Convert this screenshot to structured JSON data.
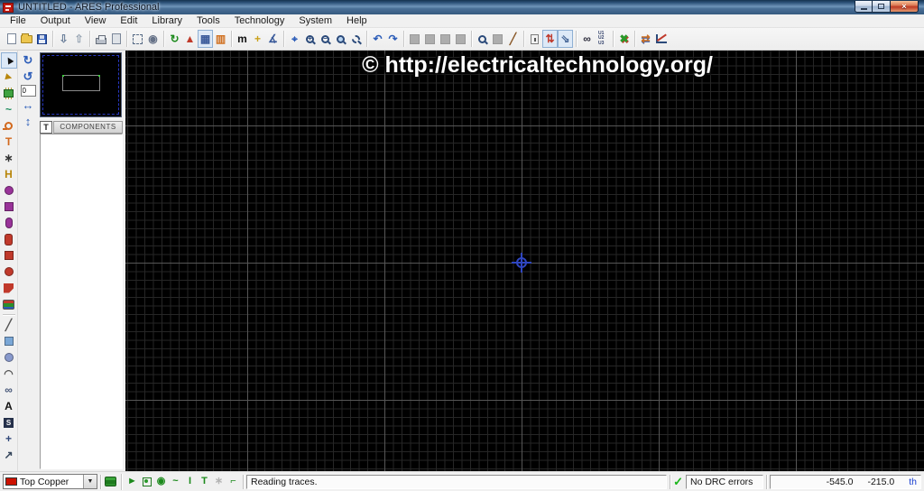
{
  "window": {
    "title": "UNTITLED - ARES Professional"
  },
  "title_bar": {
    "close_glyph": "×"
  },
  "menu_bar": {
    "items": [
      {
        "label": "File"
      },
      {
        "label": "Output"
      },
      {
        "label": "View"
      },
      {
        "label": "Edit"
      },
      {
        "label": "Library"
      },
      {
        "label": "Tools"
      },
      {
        "label": "Technology"
      },
      {
        "label": "System"
      },
      {
        "label": "Help"
      }
    ]
  },
  "main_toolbar": {
    "groups": [
      [
        {
          "name": "new-document-button",
          "shape": "page"
        },
        {
          "name": "open-design-button",
          "shape": "folder"
        },
        {
          "name": "save-design-button",
          "shape": "floppy"
        }
      ],
      [
        {
          "name": "import-region-button",
          "glyph": "⇩",
          "color": "#6b7f9a"
        },
        {
          "name": "export-region-button",
          "glyph": "⇧",
          "color": "#9aa7b5"
        }
      ],
      [
        {
          "name": "print-button",
          "shape": "printer"
        },
        {
          "name": "print-marked-area-button",
          "shape": "page2"
        }
      ],
      [
        {
          "name": "mark-output-area-button",
          "shape": "dashed"
        },
        {
          "name": "export-graphics-button",
          "glyph": "◉",
          "color": "#667288"
        }
      ],
      [
        {
          "name": "redraw-button",
          "glyph": "↻",
          "color": "#1c8a1c"
        },
        {
          "name": "flip-view-button",
          "glyph": "▲",
          "color": "#c03a2a"
        },
        {
          "name": "grid-toggle-button",
          "glyph": "▦",
          "color": "#3a5a9a",
          "state": "pressed"
        },
        {
          "name": "layers-view-button",
          "glyph": "▥",
          "color": "#d07020"
        }
      ],
      [
        {
          "name": "metric-toggle-button",
          "glyph": "m",
          "color": "#111111"
        },
        {
          "name": "false-origin-button",
          "glyph": "+",
          "color": "#caa11a"
        },
        {
          "name": "x-cursor-button",
          "glyph": "∡",
          "color": "#3a5a9a"
        }
      ],
      [
        {
          "name": "center-at-cursor-button",
          "glyph": "⌖",
          "color": "#2b5cb8"
        },
        {
          "name": "zoom-in-button",
          "shape": "mag",
          "text": "+"
        },
        {
          "name": "zoom-out-button",
          "shape": "mag",
          "text": "−"
        },
        {
          "name": "zoom-all-button",
          "shape": "mag",
          "variant": "fill"
        },
        {
          "name": "zoom-area-button",
          "shape": "mag",
          "variant": "dash"
        }
      ],
      [
        {
          "name": "undo-button",
          "glyph": "↶",
          "color": "#2b5cb8"
        },
        {
          "name": "redo-button",
          "glyph": "↷",
          "color": "#2b5cb8"
        }
      ],
      [
        {
          "name": "block-copy-button",
          "shape": "block",
          "state": "disabled"
        },
        {
          "name": "block-move-button",
          "shape": "block",
          "state": "disabled"
        },
        {
          "name": "block-rotate-button",
          "shape": "block",
          "state": "disabled"
        },
        {
          "name": "block-delete-button",
          "shape": "block",
          "state": "disabled"
        }
      ],
      [
        {
          "name": "pick-parts-button",
          "shape": "mag"
        },
        {
          "name": "make-package-button",
          "shape": "block",
          "state": "disabled"
        },
        {
          "name": "edit-tool-button",
          "glyph": "╱",
          "color": "#8a5a2a"
        }
      ],
      [
        {
          "name": "trace-lock-button",
          "shape": "lock"
        },
        {
          "name": "auto-necking-button",
          "glyph": "⇅",
          "color": "#c0392b",
          "state": "pressed"
        },
        {
          "name": "snap-cursor-button",
          "glyph": "⇘",
          "color": "#4a6a9a",
          "state": "pressed"
        }
      ],
      [
        {
          "name": "search-tag-button",
          "glyph": "∞",
          "color": "#2a2a3a"
        },
        {
          "name": "design-explorer-button",
          "shape": "ulist",
          "text": "U1 U2 U3"
        }
      ],
      [
        {
          "name": "auto-router-button",
          "glyph": "✖",
          "color": "#2a9a2a",
          "shadow": "1px 1px 0 #c0392b"
        }
      ],
      [
        {
          "name": "gateswap-button",
          "glyph": "⇄",
          "color": "#d07020",
          "shadow": "0 1px 0 #2b5cb8"
        },
        {
          "name": "drc-report-button",
          "shape": "chart"
        }
      ]
    ]
  },
  "side_toolbar": {
    "icons": [
      {
        "name": "selection-tool-button",
        "glyph": "►",
        "color": "#111111",
        "rotate": -120,
        "state": "pressed"
      },
      {
        "name": "component-mode-button",
        "glyph": "►",
        "color": "#b8860b",
        "rotate": 15
      },
      {
        "name": "package-mode-button",
        "shape": "ic"
      },
      {
        "name": "track-mode-button",
        "glyph": "~",
        "color": "#1a8a5a"
      },
      {
        "name": "via-mode-button",
        "shape": "via",
        "color": "#d2691e"
      },
      {
        "name": "zone-mode-button",
        "glyph": "T",
        "color": "#d2691e"
      },
      {
        "name": "ratsnest-mode-button",
        "glyph": "∗",
        "color": "#333333"
      },
      {
        "name": "connectivity-rule-button",
        "glyph": "H",
        "color": "#b8860b"
      },
      {
        "name": "round-pad-button",
        "shape": "circle",
        "color": "#993399"
      },
      {
        "name": "square-pad-button",
        "shape": "square",
        "color": "#993399"
      },
      {
        "name": "dil-pad-button",
        "shape": "stadium",
        "color": "#993399"
      },
      {
        "name": "edge-connector-pad-button",
        "shape": "tallround",
        "color": "#c0392b"
      },
      {
        "name": "rect-smt-pad-button",
        "shape": "square",
        "color": "#c0392b"
      },
      {
        "name": "circular-smt-pad-button",
        "shape": "circle",
        "color": "#c0392b"
      },
      {
        "name": "polygonal-smt-pad-button",
        "shape": "poly",
        "color": "#c0392b"
      },
      {
        "name": "padstack-button",
        "shape": "layers"
      },
      {
        "divider": true
      },
      {
        "name": "line-2d-button",
        "glyph": "╱",
        "color": "#555555"
      },
      {
        "name": "box-2d-button",
        "shape": "square",
        "color": "#7aa7d6"
      },
      {
        "name": "circle-2d-button",
        "shape": "circle",
        "color": "#8899cc"
      },
      {
        "name": "arc-2d-button",
        "glyph": "◠",
        "color": "#555555"
      },
      {
        "name": "path-2d-button",
        "glyph": "∞",
        "color": "#445577"
      },
      {
        "name": "text-2d-button",
        "glyph": "A",
        "color": "#111111"
      },
      {
        "name": "symbol-2d-button",
        "shape": "sbox",
        "text": "S"
      },
      {
        "name": "marker-2d-button",
        "glyph": "+",
        "color": "#334a7a"
      },
      {
        "name": "dimension-2d-button",
        "glyph": "↗",
        "color": "#33445a"
      }
    ]
  },
  "orientation": {
    "rotate_cw_glyph": "↻",
    "rotate_ccw_glyph": "↺",
    "angle_value": "0",
    "flip_h_glyph": "↔",
    "flip_v_glyph": "↕"
  },
  "object_selector": {
    "toggle_label": "T",
    "header": "COMPONENTS"
  },
  "canvas": {
    "watermark": "© http://electricaltechnology.org/"
  },
  "status_bar": {
    "layer_selector": {
      "value": "Top Copper",
      "swatch_color": "#cc1100",
      "dropdown_glyph": "▼"
    },
    "tools": [
      {
        "name": "layer-visibility-button",
        "shape": "glayers"
      },
      {
        "divider": true
      },
      {
        "name": "trace-mode-status-button",
        "glyph": "►",
        "color": "#1c8a1c"
      },
      {
        "name": "pad-status-button",
        "shape": "dotsq"
      },
      {
        "name": "via-status-button",
        "glyph": "◉",
        "color": "#1c8a1c"
      },
      {
        "name": "track-status-button",
        "glyph": "~",
        "color": "#1c8a1c"
      },
      {
        "name": "width-status-button",
        "glyph": "I",
        "color": "#1c8a1c"
      },
      {
        "name": "zone-status-button",
        "glyph": "T",
        "color": "#1c8a1c"
      },
      {
        "name": "ratsnest-status-button",
        "glyph": "∗",
        "color": "#aaaaaa",
        "state": "disabled"
      },
      {
        "name": "tidy-status-button",
        "glyph": "⌐",
        "color": "#1c8a1c"
      }
    ],
    "message": "Reading traces.",
    "drc": {
      "ok_glyph": "✓",
      "status": "No DRC errors"
    },
    "coords": {
      "x": "-545.0",
      "y": "-215.0",
      "unit": "th"
    }
  }
}
